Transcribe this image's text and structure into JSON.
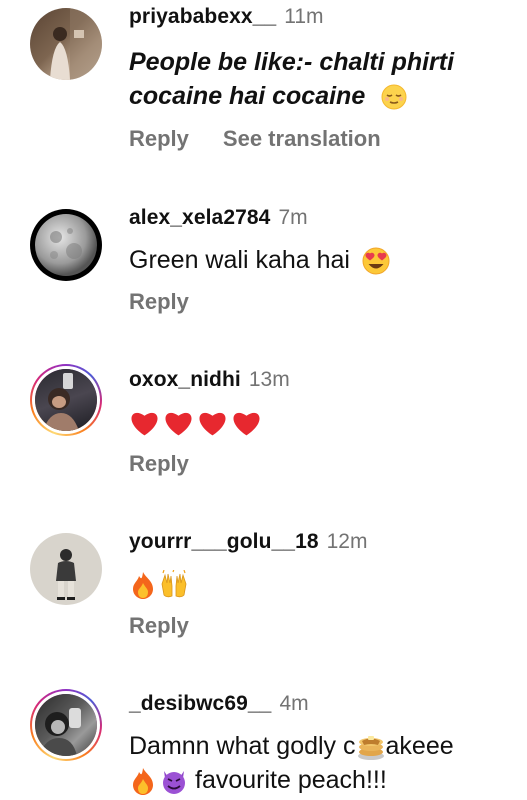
{
  "comments": [
    {
      "username": "priyababexx__",
      "time": "11m",
      "text_line1": "People be like:- chalti phirti",
      "text_line2": "cocaine hai cocaine",
      "reply": "Reply",
      "see_translation": "See translation"
    },
    {
      "username": "alex_xela2784",
      "time": "7m",
      "text": "Green wali kaha hai",
      "reply": "Reply"
    },
    {
      "username": "oxox_nidhi",
      "time": "13m",
      "reply": "Reply"
    },
    {
      "username": "yourrr___golu__18",
      "time": "12m",
      "reply": "Reply"
    },
    {
      "username": "_desibwc69__",
      "time": "4m",
      "text_line1_part1": "Damnn what godly c",
      "text_line1_part2": "akeee",
      "text_line2": "favourite peach!!!"
    }
  ],
  "icons": [
    "relieved-face-emoji",
    "heart-eyes-emoji",
    "red-heart-emoji",
    "fire-emoji",
    "raising-hands-emoji",
    "pancakes-emoji",
    "smiling-devil-emoji"
  ]
}
